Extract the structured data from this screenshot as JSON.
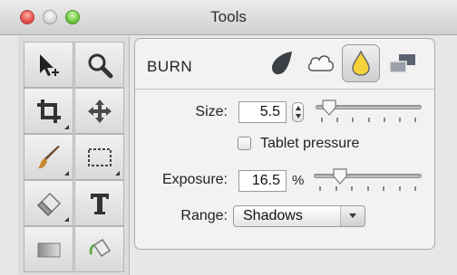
{
  "window": {
    "title": "Tools"
  },
  "tools": [
    {
      "name": "move-pointer-tool",
      "icon": "arrow-move-icon"
    },
    {
      "name": "zoom-tool",
      "icon": "magnifier-icon"
    },
    {
      "name": "crop-tool",
      "icon": "crop-icon"
    },
    {
      "name": "pan-tool",
      "icon": "four-arrows-icon"
    },
    {
      "name": "brush-tool",
      "icon": "paintbrush-icon"
    },
    {
      "name": "marquee-tool",
      "icon": "dashed-rect-icon"
    },
    {
      "name": "eraser-tool",
      "icon": "eraser-icon"
    },
    {
      "name": "text-tool",
      "icon": "text-t-icon"
    },
    {
      "name": "gradient-tool",
      "icon": "gradient-rect-icon"
    },
    {
      "name": "fill-tool",
      "icon": "paint-bucket-icon"
    }
  ],
  "panel": {
    "title": "BURN",
    "modes": [
      {
        "name": "burn-mode",
        "icon": "burn-drop-icon"
      },
      {
        "name": "cloud-mode",
        "icon": "cloud-icon"
      },
      {
        "name": "drop-mode",
        "icon": "droplet-icon",
        "selected": true
      },
      {
        "name": "layers-mode",
        "icon": "stacked-rects-icon"
      }
    ],
    "size": {
      "label": "Size:",
      "value": "5.5",
      "slider_fraction": 0.06
    },
    "tablet": {
      "label": "Tablet pressure",
      "checked": false
    },
    "exposure": {
      "label": "Exposure:",
      "value": "16.5",
      "unit": "%",
      "slider_fraction": 0.2
    },
    "range": {
      "label": "Range:",
      "value": "Shadows"
    }
  },
  "colors": {
    "accent": "#2a6fd6",
    "traffic_close": "#e4514b",
    "traffic_min": "#d8d8d8",
    "traffic_max": "#6cc93d"
  }
}
